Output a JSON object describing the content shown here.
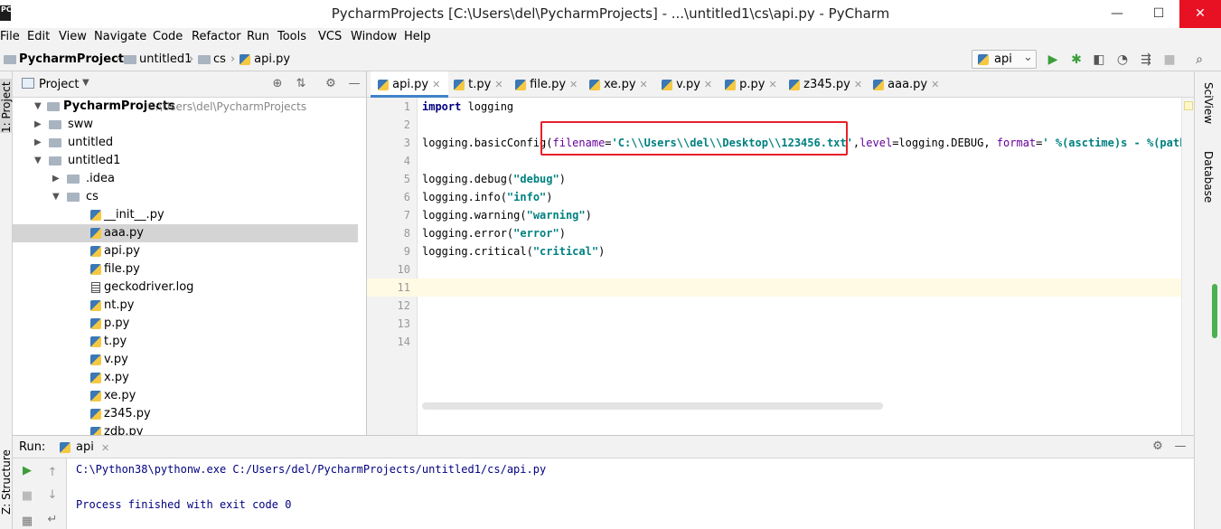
{
  "window": {
    "title": "PycharmProjects [C:\\Users\\del\\PycharmProjects] - ...\\untitled1\\cs\\api.py - PyCharm",
    "app_icon": "PC",
    "minimize": "—",
    "maximize": "☐",
    "close": "✕"
  },
  "menu": [
    "File",
    "Edit",
    "View",
    "Navigate",
    "Code",
    "Refactor",
    "Run",
    "Tools",
    "VCS",
    "Window",
    "Help"
  ],
  "breadcrumb": [
    "PycharmProjects",
    "untitled1",
    "cs",
    "api.py"
  ],
  "run_config": {
    "name": "api",
    "dropdown": "⌄"
  },
  "toolbar_icons": [
    "run-icon",
    "debug-icon",
    "coverage-icon",
    "profile-icon",
    "concurrency-icon",
    "stop-icon",
    "search-icon"
  ],
  "left_stripe": {
    "project": "1: Project",
    "structure": "Z: Structure"
  },
  "right_stripe": {
    "sciview": "SciView",
    "database": "Database"
  },
  "project_panel": {
    "title": "Project",
    "root": {
      "name": "PycharmProjects",
      "path": "C:\\Users\\del\\PycharmProjects"
    },
    "items": [
      {
        "label": "sww",
        "kind": "folder",
        "depth": 1,
        "state": "collapsed"
      },
      {
        "label": "untitled",
        "kind": "folder",
        "depth": 1,
        "state": "collapsed"
      },
      {
        "label": "untitled1",
        "kind": "folder",
        "depth": 1,
        "state": "expanded"
      },
      {
        "label": ".idea",
        "kind": "folder",
        "depth": 2,
        "state": "collapsed"
      },
      {
        "label": "cs",
        "kind": "folder",
        "depth": 2,
        "state": "expanded"
      },
      {
        "label": "__init__.py",
        "kind": "py",
        "depth": 3
      },
      {
        "label": "aaa.py",
        "kind": "py",
        "depth": 3,
        "selected": true
      },
      {
        "label": "api.py",
        "kind": "py",
        "depth": 3
      },
      {
        "label": "file.py",
        "kind": "py",
        "depth": 3
      },
      {
        "label": "geckodriver.log",
        "kind": "log",
        "depth": 3
      },
      {
        "label": "nt.py",
        "kind": "py",
        "depth": 3
      },
      {
        "label": "p.py",
        "kind": "py",
        "depth": 3
      },
      {
        "label": "t.py",
        "kind": "py",
        "depth": 3
      },
      {
        "label": "v.py",
        "kind": "py",
        "depth": 3
      },
      {
        "label": "x.py",
        "kind": "py",
        "depth": 3
      },
      {
        "label": "xe.py",
        "kind": "py",
        "depth": 3
      },
      {
        "label": "z345.py",
        "kind": "py",
        "depth": 3
      },
      {
        "label": "zdb.py",
        "kind": "py",
        "depth": 3
      }
    ]
  },
  "tabs": [
    {
      "label": "api.py",
      "active": true
    },
    {
      "label": "t.py"
    },
    {
      "label": "file.py"
    },
    {
      "label": "xe.py"
    },
    {
      "label": "v.py"
    },
    {
      "label": "p.py"
    },
    {
      "label": "z345.py"
    },
    {
      "label": "aaa.py"
    }
  ],
  "editor": {
    "line_numbers": [
      "1",
      "2",
      "3",
      "4",
      "5",
      "6",
      "7",
      "8",
      "9",
      "10",
      "11",
      "12",
      "13",
      "14"
    ],
    "current_line": 11,
    "lines": {
      "l1_kw": "import",
      "l1_rest": " logging",
      "l3_a": "logging.basicConfig(",
      "l3_p1": "filename",
      "l3_eq1": "=",
      "l3_s1": "'C:\\\\Users\\\\del\\\\Desktop\\\\123456.txt'",
      "l3_comma": ",",
      "l3_p2": "level",
      "l3_b": "=logging.DEBUG, ",
      "l3_p3": "format",
      "l3_eq3": "=",
      "l3_s3": "' %(asctime)s - %(pathname",
      "l5_a": "logging.debug(",
      "l5_s": "\"debug\"",
      "l5_b": ")",
      "l6_a": "logging.info(",
      "l6_s": "\"info\"",
      "l6_b": ")",
      "l7_a": "logging.warning(",
      "l7_s": "\"warning\"",
      "l7_b": ")",
      "l8_a": "logging.error(",
      "l8_s": "\"error\"",
      "l8_b": ")",
      "l9_a": "logging.critical(",
      "l9_s": "\"critical\"",
      "l9_b": ")"
    }
  },
  "run_panel": {
    "label": "Run:",
    "tab": "api",
    "output": [
      "C:\\Python38\\pythonw.exe C:/Users/del/PycharmProjects/untitled1/cs/api.py",
      "",
      "Process finished with exit code 0"
    ]
  },
  "colors": {
    "keyword": "#000080",
    "string": "#008080",
    "parameter": "#660099",
    "highlight_box": "#e8202b",
    "active_tab_underline": "#4083c9"
  }
}
